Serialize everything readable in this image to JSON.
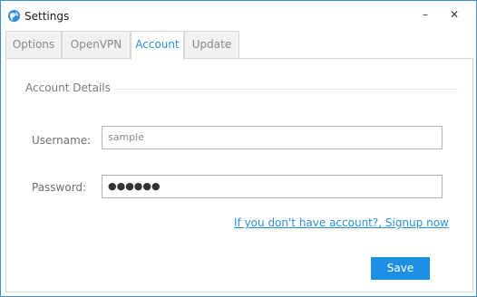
{
  "window": {
    "title": "Settings",
    "minimize_glyph": "–",
    "close_glyph": "✕",
    "icon": "globe-icon",
    "accent_color": "#2c8fd6"
  },
  "tabs": [
    {
      "label": "Options",
      "active": false
    },
    {
      "label": "OpenVPN",
      "active": false
    },
    {
      "label": "Account",
      "active": true
    },
    {
      "label": "Update",
      "active": false
    }
  ],
  "account": {
    "group_title": "Account Details",
    "username_label": "Username:",
    "username_value": "sample",
    "password_label": "Password:",
    "password_value": "●●●●●●",
    "signup_link": "If you don't have account?, Signup now",
    "save_label": "Save"
  }
}
